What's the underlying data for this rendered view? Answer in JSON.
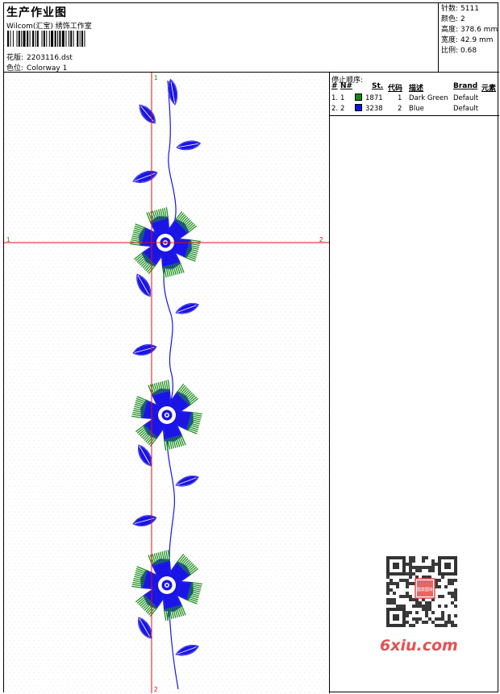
{
  "header": {
    "title": "生产作业图",
    "studio": "Wilcom(汇宝) 绣饰工作室",
    "design_label": "花版:",
    "design_value": "2203116.dst",
    "colorway_label": "色位:",
    "colorway_value": "Colorway 1"
  },
  "stats": [
    {
      "label": "针数:",
      "value": "5111"
    },
    {
      "label": "颜色:",
      "value": "2"
    },
    {
      "label": "高度:",
      "value": "378.6 mm"
    },
    {
      "label": "宽度:",
      "value": "42.9 mm"
    },
    {
      "label": "比例:",
      "value": "0.68"
    }
  ],
  "canvas": {
    "vertical_axis_start": "1",
    "vertical_axis_end": "2",
    "horizontal_axis_start": "1",
    "horizontal_axis_end": "2"
  },
  "sequence": {
    "title": "停止顺序:",
    "columns": {
      "hash": "#",
      "no": "N#",
      "stitches": "St.",
      "code": "代码",
      "description": "描述",
      "brand": "Brand",
      "elements": "元素"
    },
    "rows": [
      {
        "hash": "1.",
        "no": "1",
        "color": "#118a11",
        "stitches": "1871",
        "code": "1",
        "description": "Dark Green",
        "brand": "Default"
      },
      {
        "hash": "2.",
        "no": "2",
        "color": "#0a14e0",
        "stitches": "3238",
        "code": "2",
        "description": "Blue",
        "brand": "Default"
      }
    ]
  },
  "colors": {
    "thread_blue": "#1a14e6",
    "thread_green": "#1c8f1c",
    "axis_red": "#e01010",
    "watermark_red": "#e24a4a"
  },
  "watermark": {
    "text": "6xiu.com",
    "seal_text": "图案图库"
  }
}
